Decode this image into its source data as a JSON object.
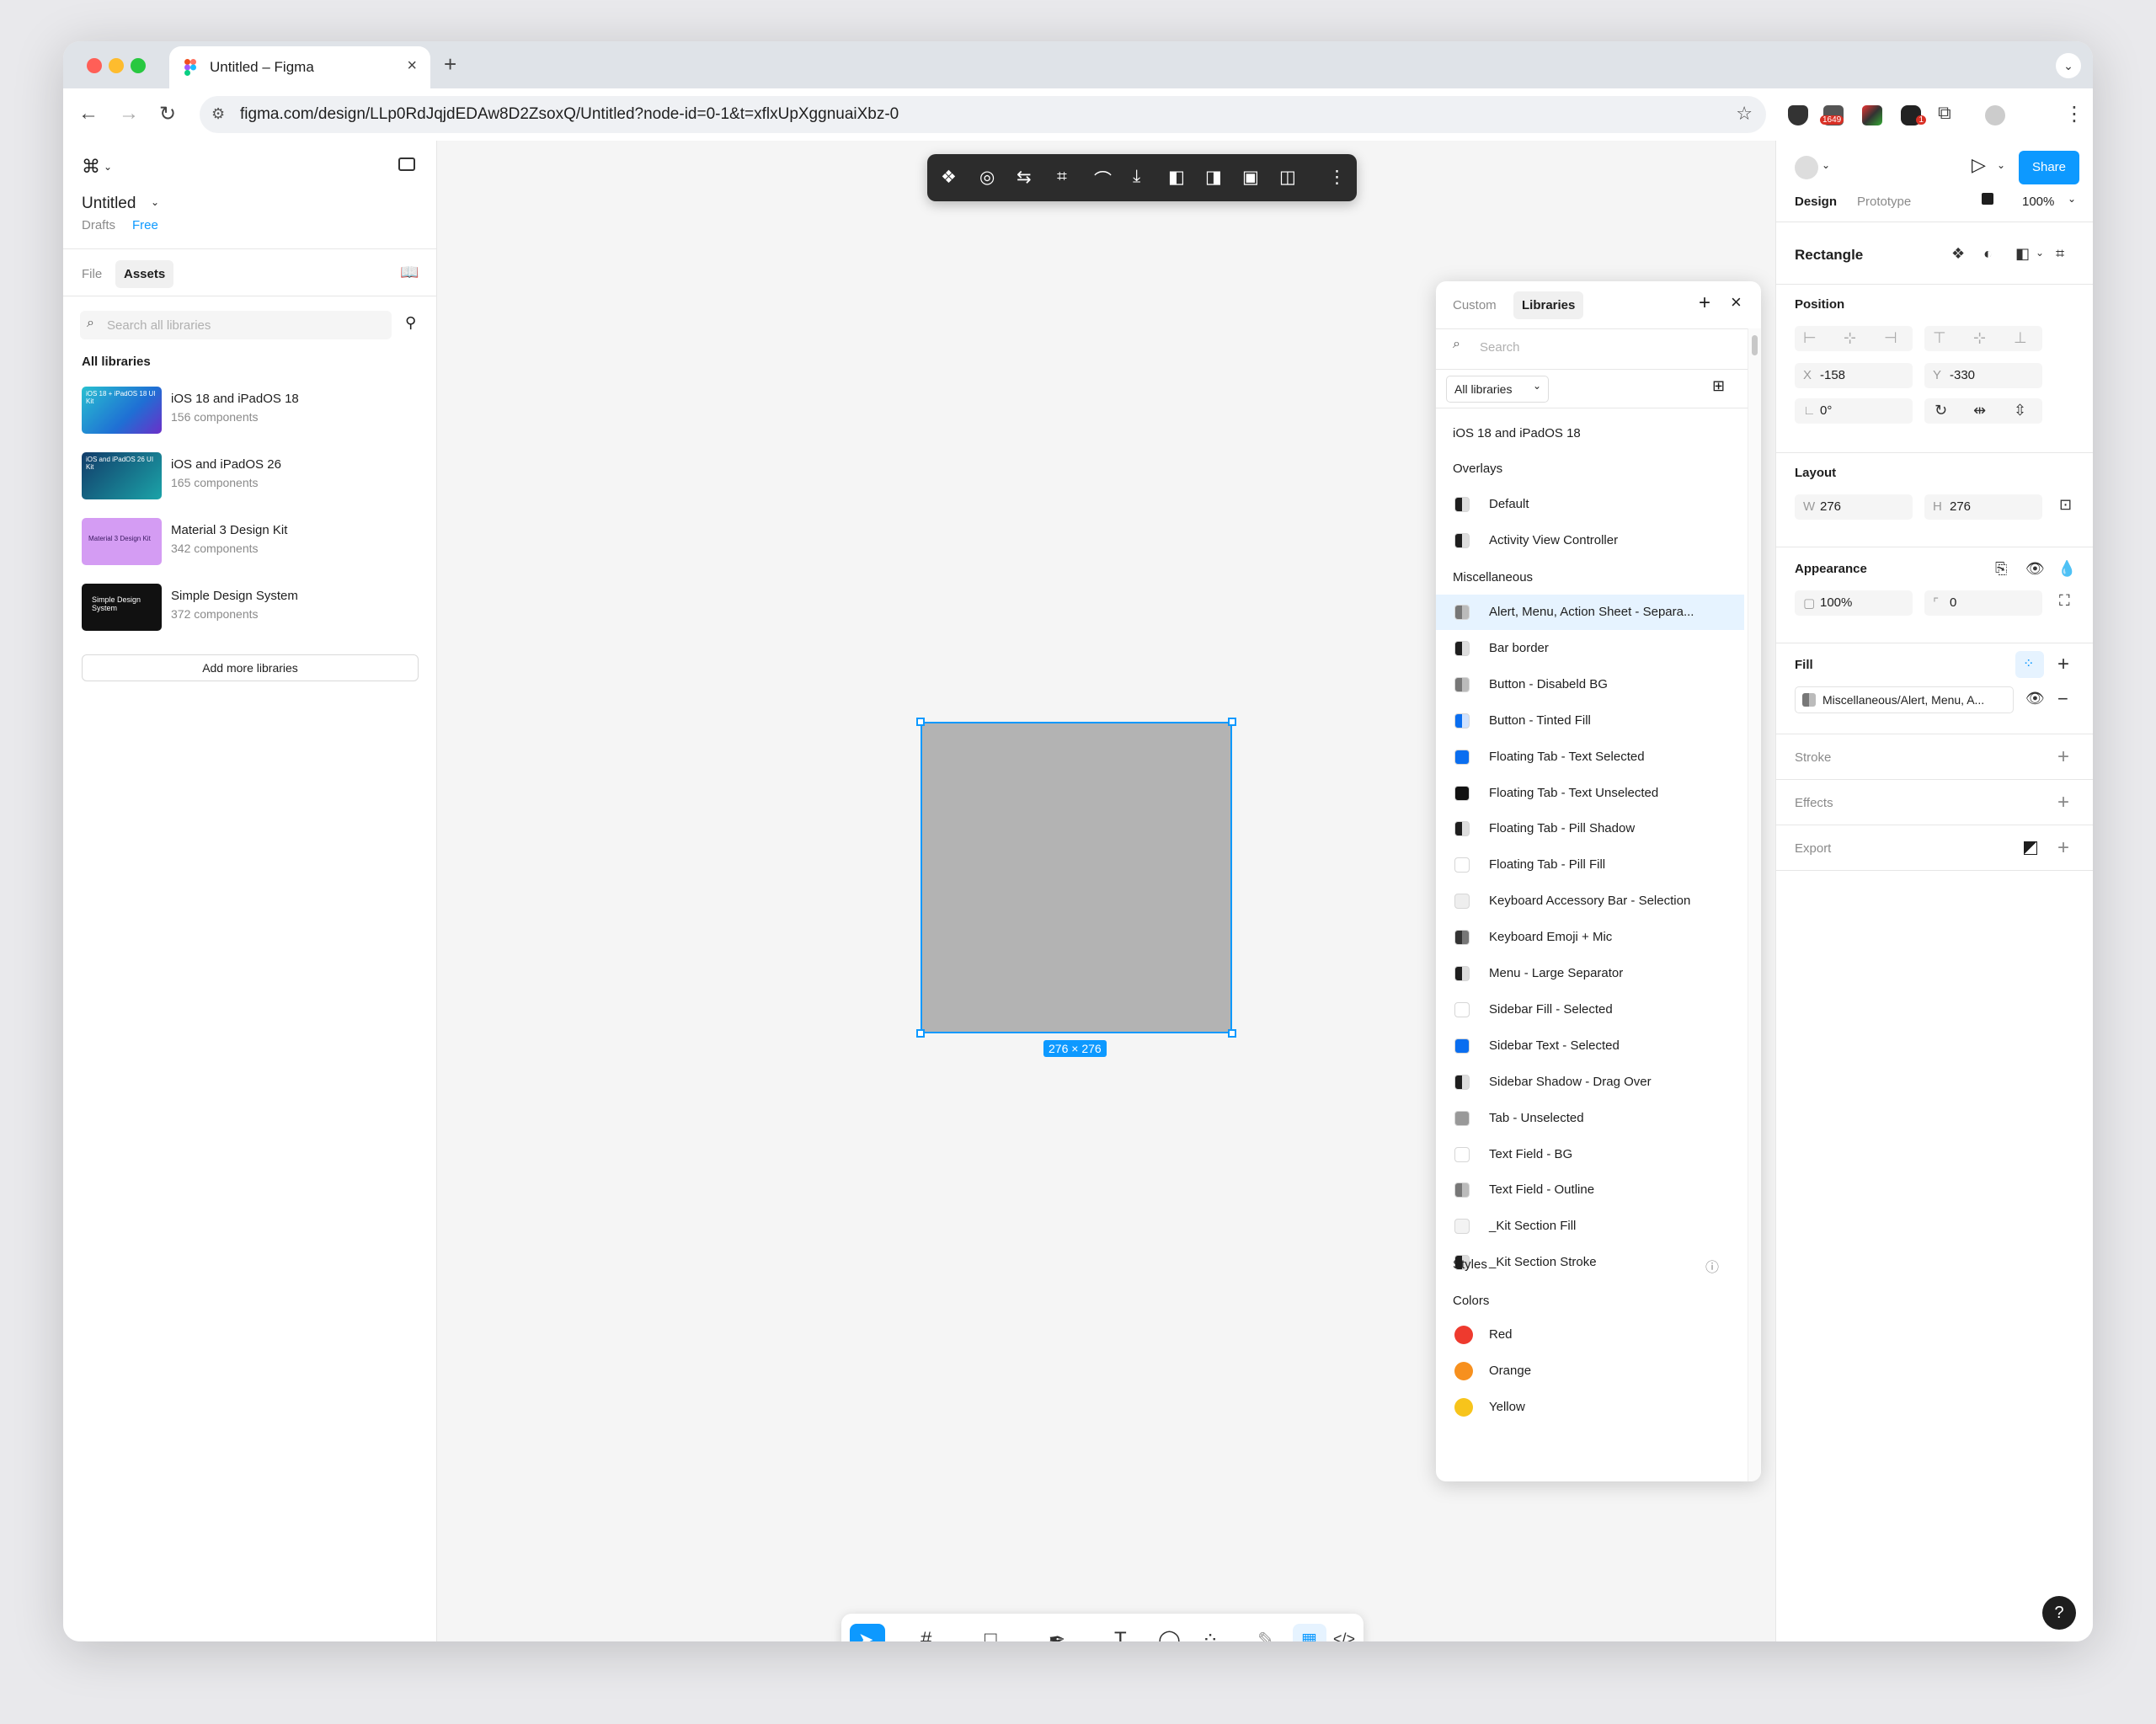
{
  "browser": {
    "tab_title": "Untitled – Figma",
    "url": "figma.com/design/LLp0RdJqjdEDAw8D2ZsoxQ/Untitled?node-id=0-1&t=xflxUpXggnuaiXbz-0",
    "ext_badge_1": "1649",
    "ext_badge_2": "1"
  },
  "left_panel": {
    "file_name": "Untitled",
    "drafts": "Drafts",
    "plan": "Free",
    "tab_file": "File",
    "tab_assets": "Assets",
    "search_placeholder": "Search all libraries",
    "all_libraries": "All libraries",
    "libraries": [
      {
        "name": "iOS 18 and iPadOS 18",
        "count": "156 components",
        "thumb_text": "iOS 18 + iPadOS 18 UI Kit",
        "color": "#1aa7c7"
      },
      {
        "name": "iOS and iPadOS 26",
        "count": "165 components",
        "thumb_text": "iOS and iPadOS 26 UI Kit",
        "color": "#1c7fa8"
      },
      {
        "name": "Material 3 Design Kit",
        "count": "342 components",
        "thumb_text": "Material 3 Design Kit",
        "color": "#c58bf0"
      },
      {
        "name": "Simple Design System",
        "count": "372 components",
        "thumb_text": "Simple Design System",
        "color": "#111111"
      }
    ],
    "add_more": "Add more libraries"
  },
  "canvas": {
    "dimensions_label": "276 × 276",
    "rect_color": "#b3b3b3"
  },
  "libraries_panel": {
    "tab_custom": "Custom",
    "tab_libraries": "Libraries",
    "search_placeholder": "Search",
    "filter": "All libraries",
    "library_title": "iOS 18 and iPadOS 18",
    "group_overlays": "Overlays",
    "overlays": [
      {
        "label": "Default",
        "swatch": "half"
      },
      {
        "label": "Activity View Controller",
        "swatch": "half"
      }
    ],
    "group_misc": "Miscellaneous",
    "misc": [
      {
        "label": "Alert, Menu, Action Sheet - Separa...",
        "swatch": "halfgray",
        "selected": true
      },
      {
        "label": "Bar border",
        "swatch": "half"
      },
      {
        "label": "Button - Disabeld BG",
        "swatch": "halfgray"
      },
      {
        "label": "Button - Tinted Fill",
        "swatch": "halfblue"
      },
      {
        "label": "Floating Tab - Text Selected",
        "swatch": "#0a6ef0"
      },
      {
        "label": "Floating Tab - Text Unselected",
        "swatch": "#111111"
      },
      {
        "label": "Floating Tab - Pill Shadow",
        "swatch": "half"
      },
      {
        "label": "Floating Tab - Pill Fill",
        "swatch": "#ffffff"
      },
      {
        "label": "Keyboard Accessory Bar - Selection",
        "swatch": "#eeeeee"
      },
      {
        "label": "Keyboard Emoji + Mic",
        "swatch": "halfdark"
      },
      {
        "label": "Menu - Large Separator",
        "swatch": "half"
      },
      {
        "label": "Sidebar Fill - Selected",
        "swatch": "#ffffff"
      },
      {
        "label": "Sidebar Text - Selected",
        "swatch": "#0a6ef0"
      },
      {
        "label": "Sidebar Shadow - Drag Over",
        "swatch": "half"
      },
      {
        "label": "Tab - Unselected",
        "swatch": "#999999"
      },
      {
        "label": "Text Field - BG",
        "swatch": "#ffffff"
      },
      {
        "label": "Text Field - Outline",
        "swatch": "halfgray"
      },
      {
        "label": "_Kit Section Fill",
        "swatch": "#f3f3f3"
      },
      {
        "label": "_Kit Section Stroke",
        "swatch": "half"
      }
    ],
    "group_styles": "Styles",
    "group_colors": "Colors",
    "colors": [
      {
        "label": "Red",
        "swatch": "#ee3a2e"
      },
      {
        "label": "Orange",
        "swatch": "#f7901e"
      },
      {
        "label": "Yellow",
        "swatch": "#f7c41b"
      }
    ]
  },
  "right_panel": {
    "play_label": "Share",
    "tab_design": "Design",
    "tab_prototype": "Prototype",
    "zoom": "100%",
    "layer_type": "Rectangle",
    "position_label": "Position",
    "x_key": "X",
    "x_val": "-158",
    "y_key": "Y",
    "y_val": "-330",
    "rot_val": "0°",
    "layout_label": "Layout",
    "w_key": "W",
    "w_val": "276",
    "h_key": "H",
    "h_val": "276",
    "appearance_label": "Appearance",
    "opacity": "100%",
    "radius": "0",
    "fill_label": "Fill",
    "fill_value": "Miscellaneous/Alert, Menu, A...",
    "stroke_label": "Stroke",
    "effects_label": "Effects",
    "export_label": "Export"
  },
  "help_label": "?"
}
